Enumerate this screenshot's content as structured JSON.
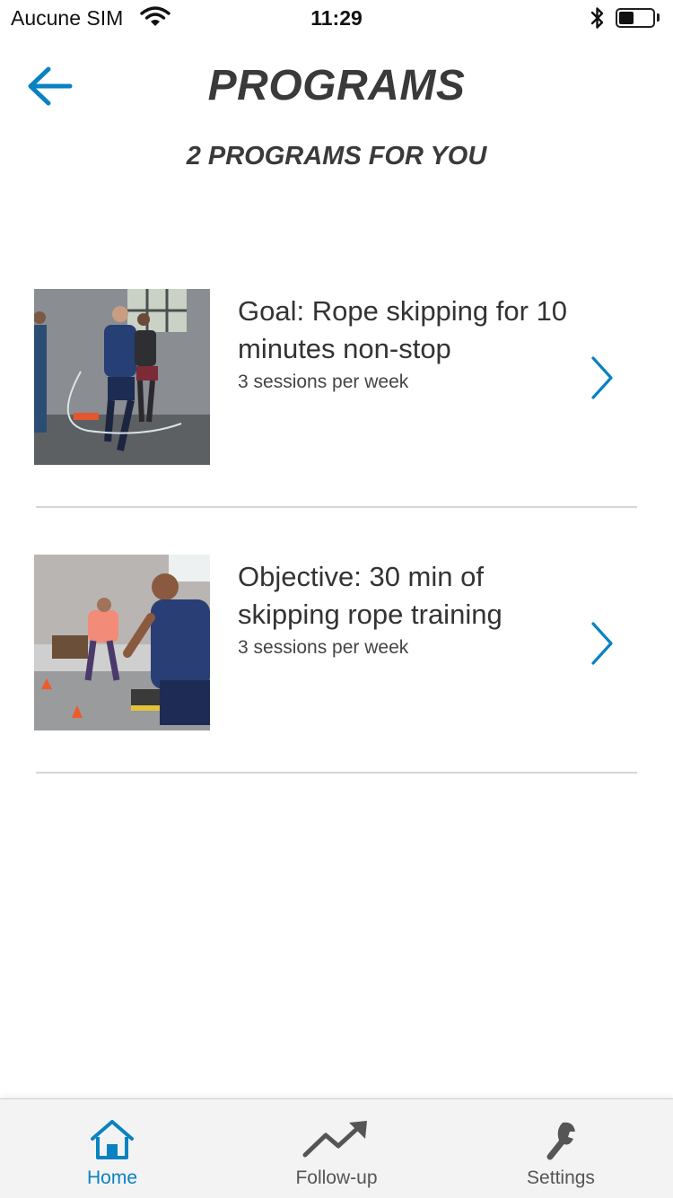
{
  "status_bar": {
    "carrier": "Aucune SIM",
    "time": "11:29",
    "battery_level": 0.45,
    "icons": [
      "wifi-icon",
      "bluetooth-icon",
      "battery-icon"
    ]
  },
  "header": {
    "back_icon": "arrow-left-icon",
    "title": "PROGRAMS",
    "subtitle": "2 PROGRAMS FOR YOU"
  },
  "programs": [
    {
      "title": "Goal: Rope skipping for 10 minutes non-stop",
      "sessions": "3 sessions per week",
      "image": "people skipping rope in a gym",
      "icon": "chevron-right-icon"
    },
    {
      "title": "Objective: 30 min of skipping rope training",
      "sessions": "3 sessions per week",
      "image": "group exercise class in a gym",
      "icon": "chevron-right-icon"
    }
  ],
  "tab_bar": {
    "active_tab": "Home",
    "tabs": [
      {
        "label": "Home",
        "icon": "home-icon"
      },
      {
        "label": "Follow-up",
        "icon": "trending-up-icon"
      },
      {
        "label": "Settings",
        "icon": "wrench-icon"
      }
    ]
  },
  "colors": {
    "accent": "#0a82c1",
    "text": "#333333",
    "divider": "#d6d6d6",
    "tab_bar_bg": "#f3f3f3"
  }
}
